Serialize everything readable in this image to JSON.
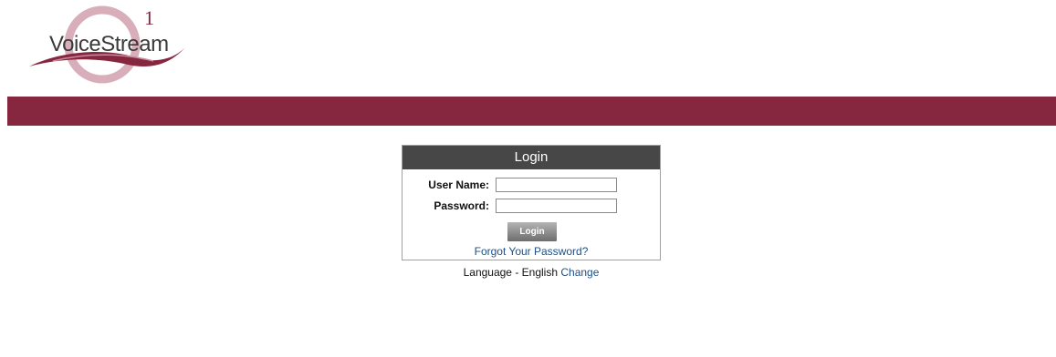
{
  "logo": {
    "text_thin": "Voice",
    "text_bold": "Stream",
    "superscript": "1"
  },
  "colors": {
    "banner": "#86273f",
    "header": "#474747",
    "link": "#1f4f86"
  },
  "login": {
    "title": "Login",
    "username_label": "User Name:",
    "username_value": "",
    "password_label": "Password:",
    "password_value": "",
    "button_label": "Login",
    "forgot_link": "Forgot Your Password?"
  },
  "language": {
    "prefix": "Language - English",
    "change_link": "Change"
  }
}
